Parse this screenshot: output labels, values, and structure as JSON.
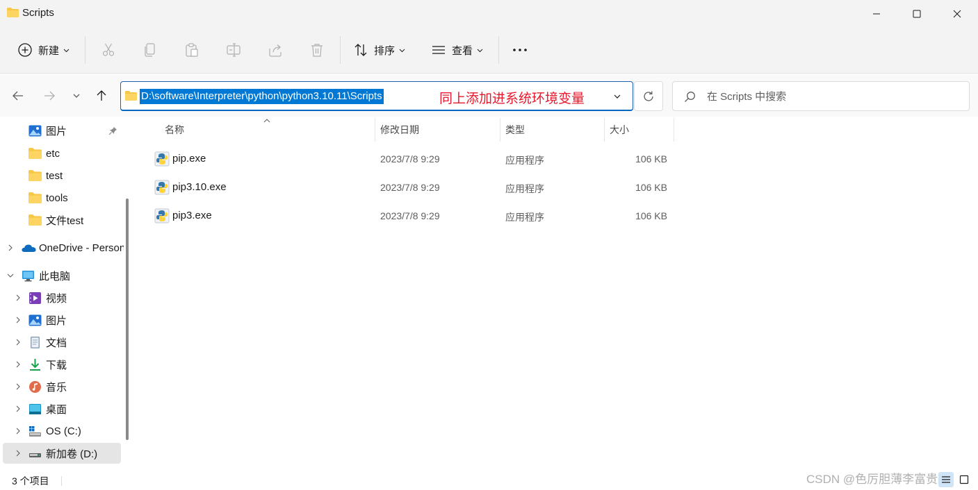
{
  "window": {
    "title": "Scripts",
    "minimize_icon": "minimize-icon",
    "maximize_icon": "maximize-icon",
    "close_icon": "close-icon"
  },
  "toolbar": {
    "new_label": "新建",
    "sort_label": "排序",
    "view_label": "查看",
    "icons": [
      "new-icon",
      "cut-icon",
      "copy-icon",
      "paste-icon",
      "rename-icon",
      "share-icon",
      "delete-icon",
      "sort-icon",
      "view-icon",
      "more-icon"
    ]
  },
  "address": {
    "path": "D:\\software\\Interpreter\\python\\python3.10.11\\Scripts",
    "annotation": "同上添加进系统环境变量",
    "annotation_color": "#e8192c",
    "selection_color": "#0078d4"
  },
  "search": {
    "placeholder": "在 Scripts 中搜索"
  },
  "sidebar": {
    "quick_access": [
      {
        "label": "图片",
        "icon": "pictures-icon",
        "pinned": true
      },
      {
        "label": "etc",
        "icon": "folder-icon"
      },
      {
        "label": "test",
        "icon": "folder-icon"
      },
      {
        "label": "tools",
        "icon": "folder-icon"
      },
      {
        "label": "文件test",
        "icon": "folder-icon"
      }
    ],
    "onedrive": {
      "label": "OneDrive - Personal",
      "icon": "onedrive-icon"
    },
    "this_pc": {
      "label": "此电脑",
      "icon": "computer-icon"
    },
    "pc_items": [
      {
        "label": "视频",
        "icon": "videos-icon"
      },
      {
        "label": "图片",
        "icon": "pictures-icon"
      },
      {
        "label": "文档",
        "icon": "documents-icon"
      },
      {
        "label": "下载",
        "icon": "downloads-icon"
      },
      {
        "label": "音乐",
        "icon": "music-icon"
      },
      {
        "label": "桌面",
        "icon": "desktop-icon"
      },
      {
        "label": "OS (C:)",
        "icon": "drive-c-icon"
      },
      {
        "label": "新加卷 (D:)",
        "icon": "drive-d-icon",
        "selected": true
      }
    ]
  },
  "columns": {
    "name": "名称",
    "date": "修改日期",
    "type": "类型",
    "size": "大小"
  },
  "files": [
    {
      "name": "pip.exe",
      "date": "2023/7/8 9:29",
      "type": "应用程序",
      "size": "106 KB"
    },
    {
      "name": "pip3.10.exe",
      "date": "2023/7/8 9:29",
      "type": "应用程序",
      "size": "106 KB"
    },
    {
      "name": "pip3.exe",
      "date": "2023/7/8 9:29",
      "type": "应用程序",
      "size": "106 KB"
    }
  ],
  "status": {
    "item_count": "3 个项目"
  },
  "watermark": "CSDN @色厉胆薄李富贵儿"
}
